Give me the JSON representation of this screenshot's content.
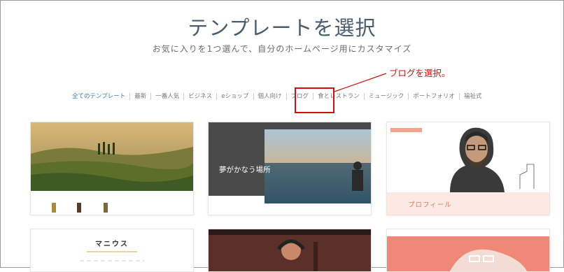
{
  "page": {
    "title": "テンプレートを選択",
    "subtitle": "お気に入りを1つ選んで、自分のホームページ用にカスタマイズ"
  },
  "nav": {
    "items": [
      "全てのテンプレート",
      "最新",
      "一番人気",
      "ビジネス",
      "eショップ",
      "個人向け",
      "ブログ",
      "食とレストラン",
      "ミュージック",
      "ポートフォリオ",
      "福祉式"
    ]
  },
  "callout": {
    "text": "ブログを選択。",
    "color": "#cc1111"
  },
  "cards": {
    "c2_text": "夢がかなう場所",
    "c3_label": "プロフィール",
    "c4_title": "マニウス"
  },
  "colors": {
    "accent": "#2e7fb8",
    "title": "#4a5d6e"
  }
}
